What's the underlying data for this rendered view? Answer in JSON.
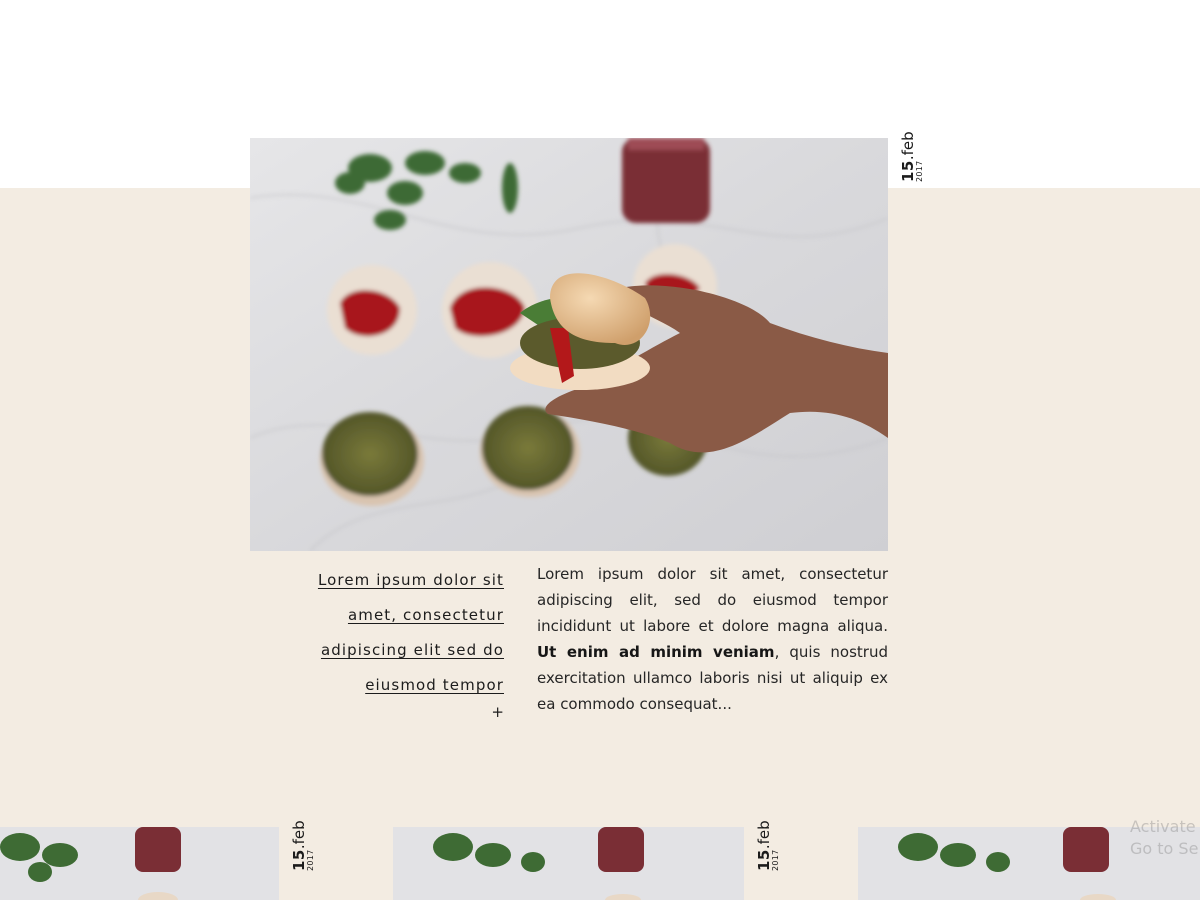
{
  "featured_post": {
    "date": {
      "day": "15",
      "month": ".feb",
      "year": "2017"
    },
    "image_alt": "hand holding veggie burger",
    "title_link": "Lorem ipsum dolor sit amet, consectetur adipiscing elit sed do eiusmod tempor",
    "more_symbol": "+",
    "excerpt": {
      "part1": "Lorem ipsum dolor sit amet, consectetur adipiscing elit, sed do eiusmod tempor incididunt ut labore et dolore magna aliqua. ",
      "bold": "Ut enim ad minim veniam",
      "part2": ", quis nostrud exercitation ullamco laboris nisi ut aliquip ex ea commodo consequat..."
    }
  },
  "post_strip": [
    {
      "date": {
        "day": "15",
        "month": ".feb",
        "year": "2017"
      }
    },
    {
      "date": {
        "day": "15",
        "month": ".feb",
        "year": "2017"
      }
    },
    {
      "date": {
        "day": "",
        "month": "",
        "year": ""
      }
    }
  ],
  "watermark": {
    "line1": "Activate",
    "line2": "Go to Se"
  },
  "colors": {
    "background": "#ffffff",
    "band": "#f3ece2",
    "text": "#1f1f1f"
  }
}
